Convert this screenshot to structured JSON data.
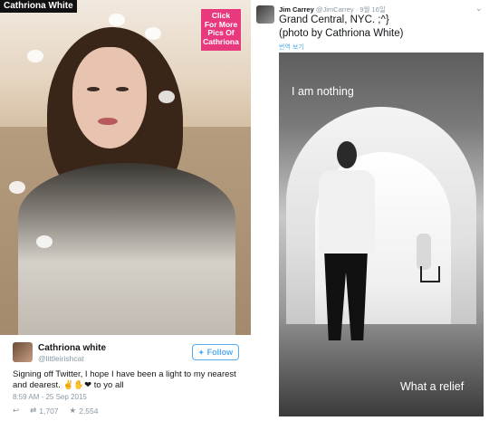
{
  "left": {
    "watermark": "Cathriona White",
    "cta_label": "Click\nFor More\nPics Of\nCathriona",
    "cta_color": "#e8397e",
    "tweet": {
      "name": "Cathriona white",
      "handle": "@littleirishcat",
      "follow_label": "Follow",
      "follow_icon": "bird-icon",
      "text": "Signing off Twitter, I hope I have been a light to my nearest and dearest. ✌️✋❤ to yo all",
      "timestamp": "8:59 AM - 25 Sep 2015",
      "retweets": "1,707",
      "favorites": "2,554",
      "icons": {
        "reply": "reply-icon",
        "retweet": "retweet-icon",
        "favorite": "star-icon"
      }
    }
  },
  "right": {
    "tweet": {
      "name": "Jim Carrey",
      "handle": "@JimCarrey",
      "date": "9월 16일",
      "line1": "Grand Central, NYC. ;^}",
      "line2": "(photo by Cathriona White)",
      "translate_label": "번역 보기"
    },
    "photo": {
      "caption_top": "I am nothing",
      "caption_bottom": "What a relief"
    }
  },
  "colors": {
    "twitter_blue": "#55acee",
    "muted_gray": "#8899a6"
  }
}
